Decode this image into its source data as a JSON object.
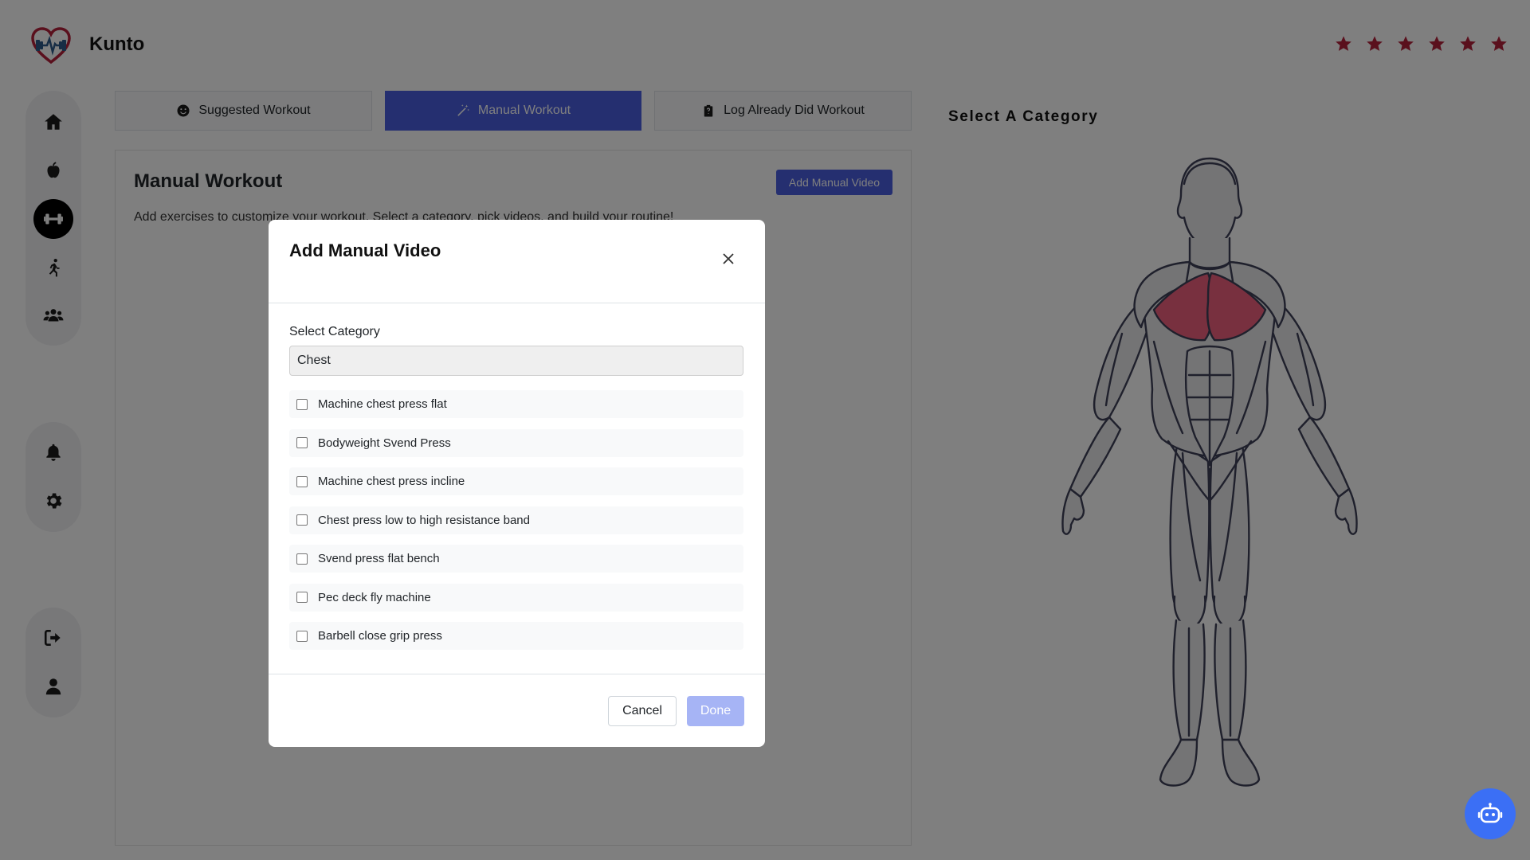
{
  "app": {
    "name": "Kunto"
  },
  "rating": {
    "stars": 6,
    "color": "#b5203a"
  },
  "tabs": [
    {
      "label": "Suggested Workout",
      "icon": "smiley-icon",
      "active": false
    },
    {
      "label": "Manual Workout",
      "icon": "magic-wand-icon",
      "active": true
    },
    {
      "label": "Log Already Did Workout",
      "icon": "clipboard-icon",
      "active": false
    }
  ],
  "sidebar": {
    "items": [
      {
        "name": "home",
        "icon": "home-icon",
        "active": false
      },
      {
        "name": "nutrition",
        "icon": "apple-icon",
        "active": false
      },
      {
        "name": "workout",
        "icon": "dumbbell-icon",
        "active": true
      },
      {
        "name": "activity",
        "icon": "running-icon",
        "active": false
      },
      {
        "name": "community",
        "icon": "users-icon",
        "active": false
      },
      {
        "name": "notifications",
        "icon": "bell-icon",
        "active": false
      },
      {
        "name": "settings",
        "icon": "gear-icon",
        "active": false
      },
      {
        "name": "logout",
        "icon": "logout-icon",
        "active": false
      },
      {
        "name": "profile",
        "icon": "user-icon",
        "active": false
      }
    ]
  },
  "main": {
    "title": "Manual Workout",
    "add_button": "Add Manual Video",
    "description": "Add exercises to customize your workout. Select a category, pick videos, and build your routine!"
  },
  "body_map": {
    "title": "Select A Category",
    "highlighted_muscle": "Chest",
    "highlight_color": "#f0607f"
  },
  "modal": {
    "title": "Add Manual Video",
    "category_label": "Select Category",
    "category_value": "Chest",
    "exercises": [
      {
        "label": "Machine chest press flat",
        "checked": false
      },
      {
        "label": "Bodyweight Svend Press",
        "checked": false
      },
      {
        "label": "Machine chest press incline",
        "checked": false
      },
      {
        "label": "Chest press low to high resistance band",
        "checked": false
      },
      {
        "label": "Svend press flat bench",
        "checked": false
      },
      {
        "label": "Pec deck fly machine",
        "checked": false
      },
      {
        "label": "Barbell close grip press",
        "checked": false
      }
    ],
    "cancel_label": "Cancel",
    "done_label": "Done"
  },
  "colors": {
    "accent": "#4a5ee0",
    "done_disabled": "#a6b4f5",
    "chat_fab": "#3b6ff5"
  },
  "chat": {
    "icon": "robot-icon"
  }
}
